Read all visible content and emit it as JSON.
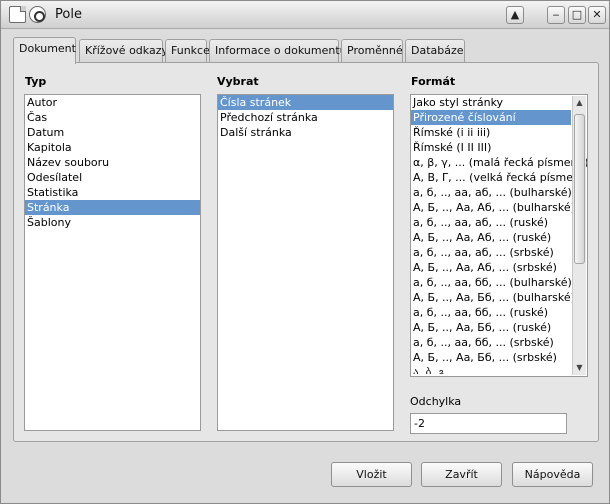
{
  "window": {
    "title": "Pole"
  },
  "titlebar_buttons": {
    "up": "▲",
    "minimize": "‒",
    "maximize": "□",
    "close": "✕"
  },
  "tabs": [
    {
      "label": "Dokument",
      "active": true
    },
    {
      "label": "Křížové odkazy"
    },
    {
      "label": "Funkce"
    },
    {
      "label": "Informace o dokumentu"
    },
    {
      "label": "Proměnné"
    },
    {
      "label": "Databáze"
    }
  ],
  "type_column": {
    "label": "Typ",
    "items": [
      "Autor",
      "Čas",
      "Datum",
      "Kapitola",
      "Název souboru",
      "Odesílatel",
      "Statistika",
      "Stránka",
      "Šablony"
    ],
    "selected": "Stránka"
  },
  "select_column": {
    "label": "Vybrat",
    "items": [
      "Čísla stránek",
      "Předchozí stránka",
      "Další stránka"
    ],
    "selected": "Čísla stránek"
  },
  "format_column": {
    "label": "Formát",
    "items": [
      "Jako styl stránky",
      "Přirozené číslování",
      "Římské (i ii iii)",
      "Římské (I II III)",
      "α, β, γ, ... (malá řecká písmena)",
      "Α, Β, Γ, ... (velká řecká písmena)",
      "а, б, .., аа, аб, ... (bulharské)",
      "А, Б, .., Аа, Аб, ... (bulharské)",
      "а, б, .., аа, аб, ... (ruské)",
      "А, Б, .., Аа, Аб, ... (ruské)",
      "а, б, .., аа, аб, ... (srbské)",
      "А, Б, .., Аа, Аб, ... (srbské)",
      "а, б, .., аа, бб, ... (bulharské)",
      "А, Б, .., Аа, Бб, ... (bulharské)",
      "а, б, .., аа, бб, ... (ruské)",
      "А, Б, .., Аа, Бб, ... (ruské)",
      "а, б, .., аа, бб, ... (srbské)",
      "А, Б, .., Аа, Бб, ... (srbské)",
      "ა, ბ, გ, ..."
    ],
    "selected": "Přirozené číslování"
  },
  "offset": {
    "label": "Odchylka",
    "value": "-2"
  },
  "buttons": {
    "insert": "Vložit",
    "close": "Zavřít",
    "help": "Nápověda"
  },
  "colors": {
    "selection": "#6496cd",
    "window_bg": "#dcdcdc"
  }
}
